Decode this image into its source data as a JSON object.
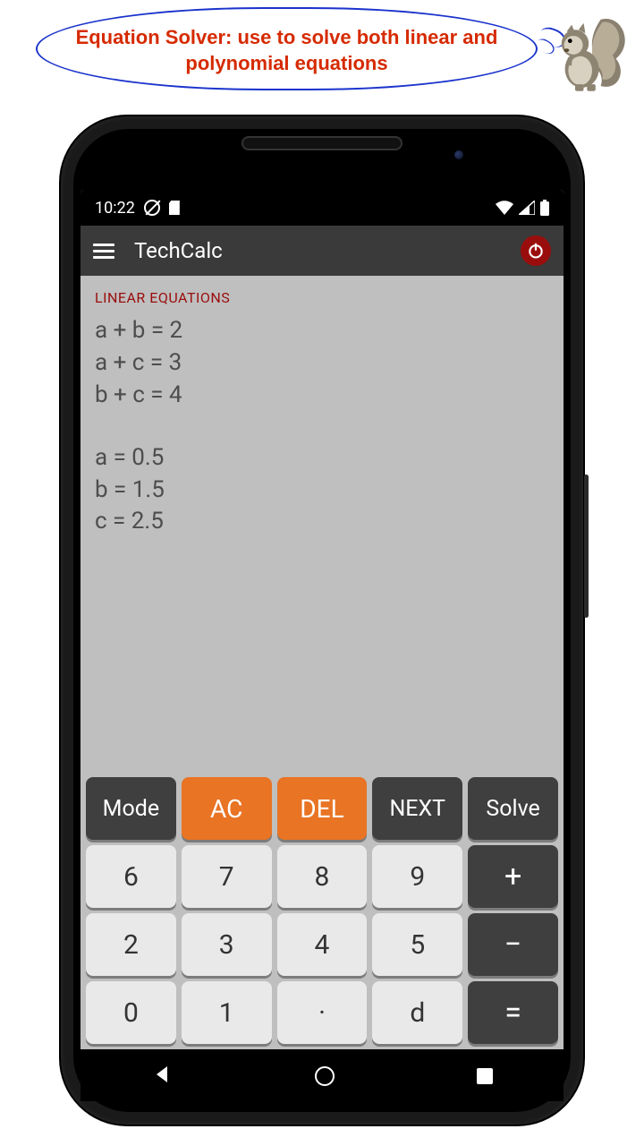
{
  "callout": {
    "text": "Equation Solver: use to solve both linear and polynomial equations"
  },
  "statusbar": {
    "time": "10:22"
  },
  "appbar": {
    "title": "TechCalc"
  },
  "display": {
    "mode_label": "LINEAR EQUATIONS",
    "equations": [
      "a + b = 2",
      "a + c = 3",
      "b + c = 4"
    ],
    "solutions": [
      "a = 0.5",
      "b = 1.5",
      "c = 2.5"
    ]
  },
  "keys": {
    "mode": "Mode",
    "ac": "AC",
    "del": "DEL",
    "next": "NEXT",
    "solve": "Solve",
    "n6": "6",
    "n7": "7",
    "n8": "8",
    "n9": "9",
    "n2": "2",
    "n3": "3",
    "n4": "4",
    "n5": "5",
    "n0": "0",
    "n1": "1",
    "dot": "·",
    "d": "d",
    "plus": "+",
    "minus": "−",
    "equals": "="
  }
}
